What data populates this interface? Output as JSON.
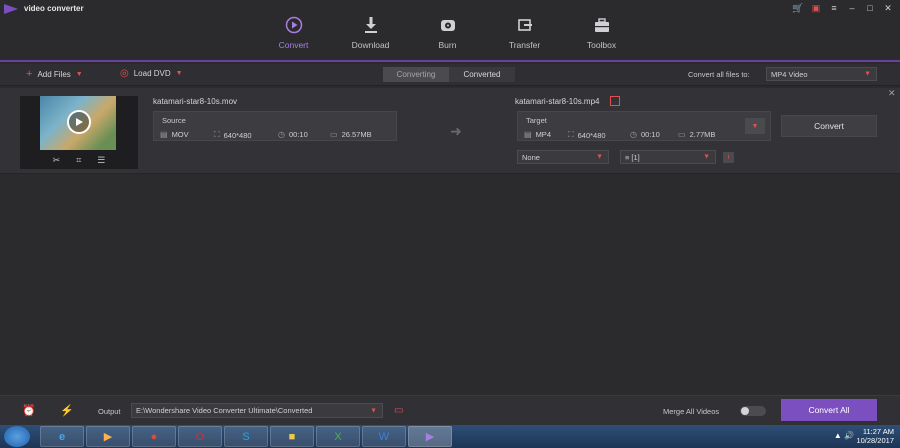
{
  "window": {
    "title": "video converter",
    "controls": [
      "cart-icon",
      "gift-icon",
      "menu-icon",
      "minimize-icon",
      "maximize-icon",
      "close-icon"
    ]
  },
  "nav": {
    "items": [
      {
        "label": "Convert",
        "icon": "convert-icon",
        "active": true
      },
      {
        "label": "Download",
        "icon": "download-icon",
        "active": false
      },
      {
        "label": "Burn",
        "icon": "burn-icon",
        "active": false
      },
      {
        "label": "Transfer",
        "icon": "transfer-icon",
        "active": false
      },
      {
        "label": "Toolbox",
        "icon": "toolbox-icon",
        "active": false
      }
    ]
  },
  "toolbar": {
    "add_files_label": "Add Files",
    "load_dvd_label": "Load DVD",
    "tab_converting": "Converting",
    "tab_converted": "Converted",
    "convert_all_label": "Convert all files to:",
    "convert_all_value": "MP4 Video"
  },
  "file": {
    "source_name": "katamari-star8-10s.mov",
    "source_box_title": "Source",
    "source": {
      "format": "MOV",
      "resolution": "640*480",
      "duration": "00:10",
      "size": "26.57MB"
    },
    "target_name": "katamari-star8-10s.mp4",
    "target_box_title": "Target",
    "target": {
      "format": "MP4",
      "resolution": "640*480",
      "duration": "00:10",
      "size": "2.77MB"
    },
    "convert_label": "Convert",
    "subtitle_select": "None",
    "audio_select": "[1]"
  },
  "bottom": {
    "output_label": "Output",
    "output_path": "E:\\Wondershare Video Converter Ultimate\\Converted",
    "merge_label": "Merge All Videos",
    "merge_on": false,
    "convert_all_btn": "Convert All"
  },
  "taskbar": {
    "time": "11:27 AM",
    "date": "10/28/2017"
  },
  "colors": {
    "accent": "#7b4fbf",
    "accent_text": "#a77fe0",
    "warning": "#e05050"
  }
}
